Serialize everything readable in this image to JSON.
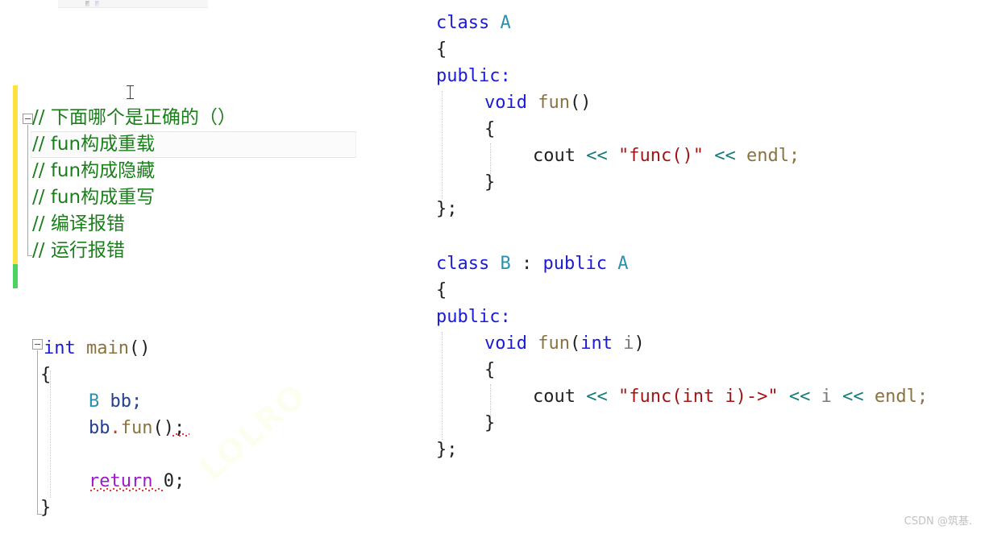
{
  "app": {
    "watermark_diagonal": "LOLRO",
    "watermark_corner": "CSDN @筑基."
  },
  "gutter": {
    "unsaved_change_color": "#ffe242",
    "saved_change_color": "#4bd362",
    "collapse_glyph": "minus"
  },
  "comment_block": {
    "lines": [
      {
        "marker": "//",
        "text": "下面哪个是正确的（）",
        "highlighted": false
      },
      {
        "marker": "//",
        "text": "fun构成重载",
        "highlighted": true
      },
      {
        "marker": "//",
        "text": "fun构成隐藏",
        "highlighted": false
      },
      {
        "marker": "//",
        "text": "fun构成重写",
        "highlighted": false
      },
      {
        "marker": "//",
        "text": "编译报错",
        "highlighted": false
      },
      {
        "marker": "//",
        "text": "运行报错",
        "highlighted": false
      }
    ]
  },
  "main_function": {
    "signature_keyword": "int",
    "signature_name": "main",
    "signature_parens": "()",
    "open_brace": "{",
    "decl_type": "B",
    "decl_var": "bb;",
    "call_object": "bb",
    "call_dot": ".",
    "call_method": "fun",
    "call_parens": "();",
    "return_keyword": "return",
    "return_value": "0;",
    "close_brace": "}"
  },
  "class_a": {
    "keyword_class": "class",
    "name": "A",
    "open_brace": "{",
    "access": "public:",
    "method_return": "void",
    "method_name": "fun",
    "method_parens": "()",
    "body_open": "{",
    "stream_object": "cout",
    "stream_op1": "<<",
    "stream_string": "\"func()\"",
    "stream_op2": "<<",
    "stream_endl": "endl;",
    "body_close": "}",
    "close_brace": "};"
  },
  "class_b": {
    "keyword_class": "class",
    "name": "B",
    "inherit_colon": ":",
    "inherit_access": "public",
    "base_name": "A",
    "open_brace": "{",
    "access": "public:",
    "method_return": "void",
    "method_name": "fun",
    "method_open_paren": "(",
    "param_type": "int",
    "param_name": "i",
    "method_close_paren": ")",
    "body_open": "{",
    "stream_object": "cout",
    "stream_op1": "<<",
    "stream_string": "\"func(int i)->\"",
    "stream_op2": "<<",
    "stream_var": "i",
    "stream_op3": "<<",
    "stream_endl": "endl;",
    "body_close": "}",
    "close_brace": "};"
  },
  "colors": {
    "comment": "#1a7f1a",
    "keyword": "#1b1bd6",
    "type": "#2b91af",
    "function": "#8a7340",
    "string": "#a31515",
    "operator": "#157b7b",
    "control": "#9b19c9",
    "error_squiggle": "#e33b3b"
  }
}
